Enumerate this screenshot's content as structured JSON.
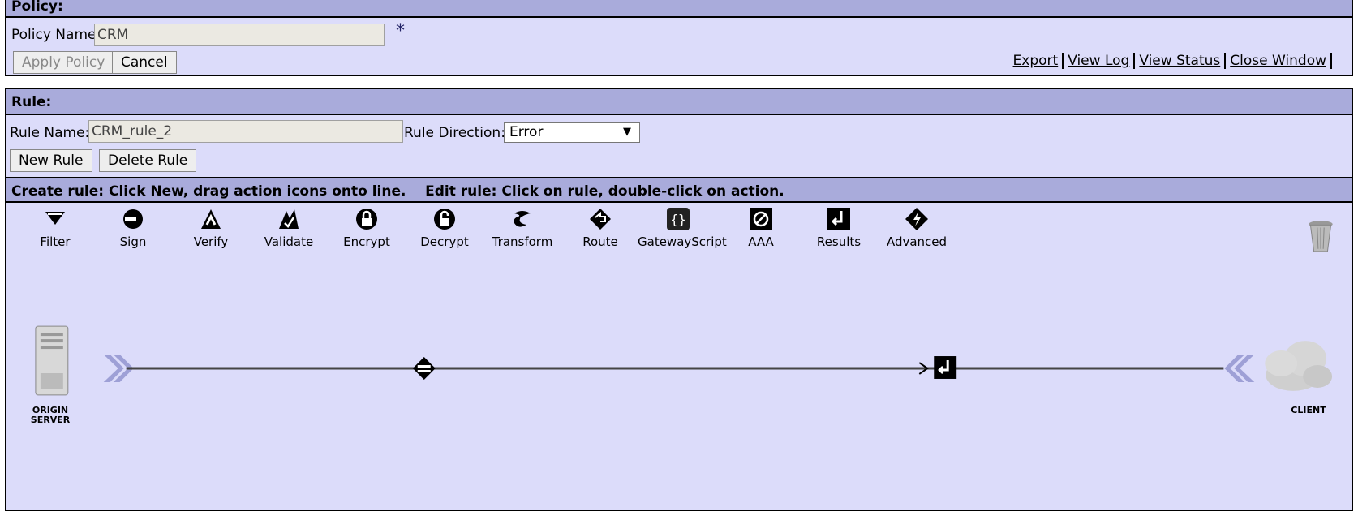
{
  "policy": {
    "header": "Policy:",
    "name_label": "Policy Name:",
    "name_value": "CRM",
    "required_mark": "*",
    "apply_button": "Apply Policy",
    "cancel_button": "Cancel",
    "links": [
      "Export",
      "View Log",
      "View Status",
      "Close Window"
    ]
  },
  "rule": {
    "header": "Rule:",
    "name_label": "Rule Name:",
    "name_value": "CRM_rule_2",
    "direction_label": "Rule Direction:",
    "direction_value": "Error",
    "new_button": "New Rule",
    "delete_button": "Delete Rule"
  },
  "editor": {
    "instructions": "Create rule: Click New, drag action icons onto line.    Edit rule: Click on rule, double-click on action.",
    "tools": [
      {
        "label": "Filter",
        "icon": "filter-icon"
      },
      {
        "label": "Sign",
        "icon": "sign-icon"
      },
      {
        "label": "Verify",
        "icon": "verify-icon"
      },
      {
        "label": "Validate",
        "icon": "validate-icon"
      },
      {
        "label": "Encrypt",
        "icon": "encrypt-icon"
      },
      {
        "label": "Decrypt",
        "icon": "decrypt-icon"
      },
      {
        "label": "Transform",
        "icon": "transform-icon"
      },
      {
        "label": "Route",
        "icon": "route-icon"
      },
      {
        "label": "GatewayScript",
        "icon": "gatewayscript-icon"
      },
      {
        "label": "AAA",
        "icon": "aaa-icon"
      },
      {
        "label": "Results",
        "icon": "results-icon"
      },
      {
        "label": "Advanced",
        "icon": "advanced-icon"
      }
    ],
    "origin_label_line1": "ORIGIN",
    "origin_label_line2": "SERVER",
    "client_label": "CLIENT"
  }
}
